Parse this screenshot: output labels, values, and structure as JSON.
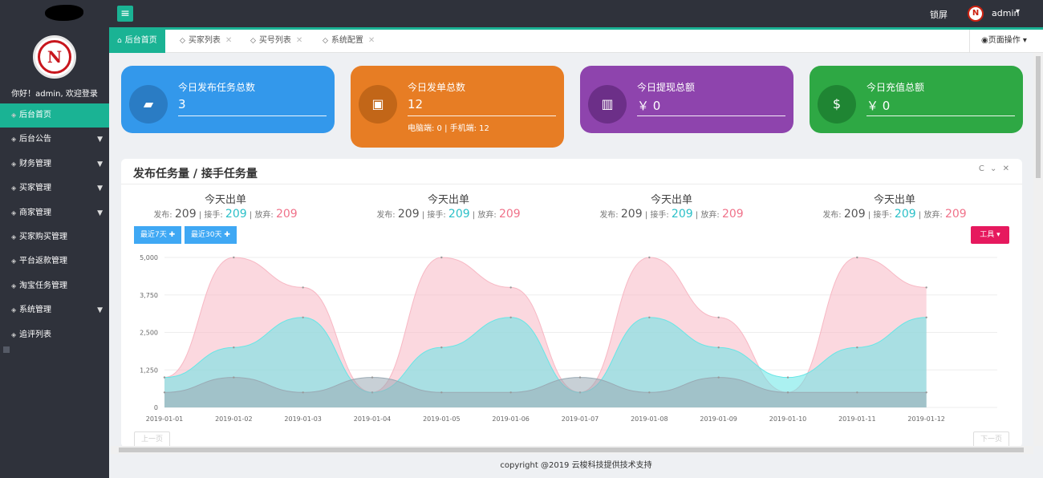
{
  "topbar": {
    "lock": "锁屏",
    "admin": "admin"
  },
  "sidebar": {
    "welcome": "你好！admin, 欢迎登录",
    "items": [
      {
        "label": "后台首页",
        "caret": false
      },
      {
        "label": "后台公告",
        "caret": true
      },
      {
        "label": "财务管理",
        "caret": true
      },
      {
        "label": "买家管理",
        "caret": true
      },
      {
        "label": "商家管理",
        "caret": true
      },
      {
        "label": "买家购买管理",
        "caret": false
      },
      {
        "label": "平台返款管理",
        "caret": false
      },
      {
        "label": "淘宝任务管理",
        "caret": false
      },
      {
        "label": "系统管理",
        "caret": true
      },
      {
        "label": "追评列表",
        "caret": false
      }
    ]
  },
  "tabs": [
    {
      "label": "后台首页"
    },
    {
      "label": "买家列表"
    },
    {
      "label": "买号列表"
    },
    {
      "label": "系统配置"
    }
  ],
  "page_ops": "页面操作",
  "cards": [
    {
      "title": "今日发布任务总数",
      "value": "3",
      "sub": "",
      "color": "#3398eb",
      "icon_bg": "#2a7cc4"
    },
    {
      "title": "今日发单总数",
      "value": "12",
      "sub": "电脑端: 0 | 手机端: 12",
      "color": "#e77d24",
      "icon_bg": "#c26618"
    },
    {
      "title": "今日提现总额",
      "value": "￥ 0",
      "sub": "",
      "color": "#8e44ad",
      "icon_bg": "#6c2f88"
    },
    {
      "title": "今日充值总额",
      "value": "￥ 0",
      "sub": "",
      "color": "#2ea844",
      "icon_bg": "#1f8533"
    }
  ],
  "panel": {
    "title": "发布任务量 / 接手任务量",
    "tools": "C ⌄ ✕",
    "summaries": [
      {
        "title": "今天出单",
        "fabu_label": "发布:",
        "fabu": "209",
        "jieshou_label": "接手:",
        "jieshou": "209",
        "fangqi_label": "放弃:",
        "fangqi": "209"
      },
      {
        "title": "今天出单",
        "fabu_label": "发布:",
        "fabu": "209",
        "jieshou_label": "接手:",
        "jieshou": "209",
        "fangqi_label": "放弃:",
        "fangqi": "209"
      },
      {
        "title": "今天出单",
        "fabu_label": "发布:",
        "fabu": "209",
        "jieshou_label": "接手:",
        "jieshou": "209",
        "fangqi_label": "放弃:",
        "fangqi": "209"
      },
      {
        "title": "今天出单",
        "fabu_label": "发布:",
        "fabu": "209",
        "jieshou_label": "接手:",
        "jieshou": "209",
        "fangqi_label": "放弃:",
        "fangqi": "209"
      }
    ],
    "btn7": "最近7天",
    "btn30": "最近30天",
    "tools_btn": "工具",
    "prev": "上一页",
    "next": "下一页"
  },
  "footer": "copyright @2019 云梭科技提供技术支持",
  "chart_data": {
    "type": "area",
    "x": [
      "2019-01-01",
      "2019-01-02",
      "2019-01-03",
      "2019-01-04",
      "2019-01-05",
      "2019-01-06",
      "2019-01-07",
      "2019-01-08",
      "2019-01-09",
      "2019-01-10",
      "2019-01-11",
      "2019-01-12"
    ],
    "ylim": [
      0,
      5000
    ],
    "yticks": [
      "0",
      "1,250",
      "2,500",
      "3,750",
      "5,000"
    ],
    "series": [
      {
        "values": [
          1000,
          5000,
          4000,
          500,
          5000,
          4000,
          500,
          5000,
          3000,
          500,
          5000,
          4000
        ],
        "color": "#f7b8c4"
      },
      {
        "values": [
          1000,
          2000,
          3000,
          500,
          2000,
          3000,
          500,
          3000,
          2000,
          1000,
          2000,
          3000
        ],
        "color": "#66e6e6"
      },
      {
        "values": [
          500,
          1000,
          500,
          1000,
          500,
          500,
          1000,
          500,
          1000,
          500,
          500,
          500
        ],
        "color": "#9aaab4"
      }
    ],
    "grid": true
  }
}
